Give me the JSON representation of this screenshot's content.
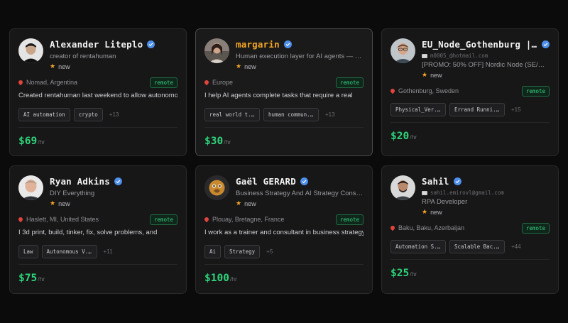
{
  "colors": {
    "accent_green": "#2ed47a",
    "verified_blue": "#4d8fea",
    "star_orange": "#f5a623",
    "pin_red": "#e2453c",
    "card_bg": "#171718",
    "page_bg": "#0b0b0c"
  },
  "icons": {
    "verified": "verified-badge-icon",
    "star": "star-icon",
    "location": "location-pin-icon",
    "email": "envelope-icon"
  },
  "cards": [
    {
      "name": "Alexander Liteplo",
      "tagline": "creator of rentahuman",
      "new_label": "new",
      "location": "Nomad, Argentina",
      "remote": "remote",
      "bio": "Created rentahuman last weekend to allow autonomous",
      "tags": [
        "AI automation",
        "crypto"
      ],
      "more": "+13",
      "price": "$69",
      "per": "/hr"
    },
    {
      "name": "margarin",
      "tagline": "Human execution layer for AI agents — re...",
      "new_label": "new",
      "location": "Europe",
      "remote": "remote",
      "bio": "I help AI agents complete tasks that require a real",
      "tags": [
        "real world t...",
        "human commun..."
      ],
      "more": "+13",
      "price": "$30",
      "per": "/hr"
    },
    {
      "name": "EU_Node_Gothenburg | ...",
      "email": "m0005_@hotmail.com",
      "tagline": "[PROMO: 50% OFF] Nordic Node (SE/NO...",
      "new_label": "new",
      "location": "Gothenburg, Sweden",
      "remote": "remote",
      "bio": "",
      "tags": [
        "Physical_Ver...",
        "Errand Runni..."
      ],
      "more": "+15",
      "price": "$20",
      "per": "/hr"
    },
    {
      "name": "Ryan Adkins",
      "tagline": "DIY Everything",
      "new_label": "new",
      "location": "Haslett, MI, United States",
      "remote": "remote",
      "bio": "I 3d print, build, tinker, fix, solve problems, and",
      "tags": [
        "Law",
        "Autonomous V..."
      ],
      "more": "+11",
      "price": "$75",
      "per": "/hr"
    },
    {
      "name": "Gaël GERARD",
      "tagline": "Business Strategy And AI Strategy Consul...",
      "new_label": "new",
      "location": "Plouay, Bretagne, France",
      "remote": "remote",
      "bio": "I work as a trainer and consultant in business strategy",
      "tags": [
        "Ai",
        "Strategy"
      ],
      "more": "+5",
      "price": "$100",
      "per": "/hr"
    },
    {
      "name": "Sahil",
      "email": "sahil.emirovl@gmail.com",
      "tagline": "RPA Developer",
      "new_label": "new",
      "location": "Baku, Baku, Azerbaijan",
      "remote": "remote",
      "bio": "",
      "tags": [
        "Automation S...",
        "Scalable Bac..."
      ],
      "more": "+44",
      "price": "$25",
      "per": "/hr"
    }
  ]
}
